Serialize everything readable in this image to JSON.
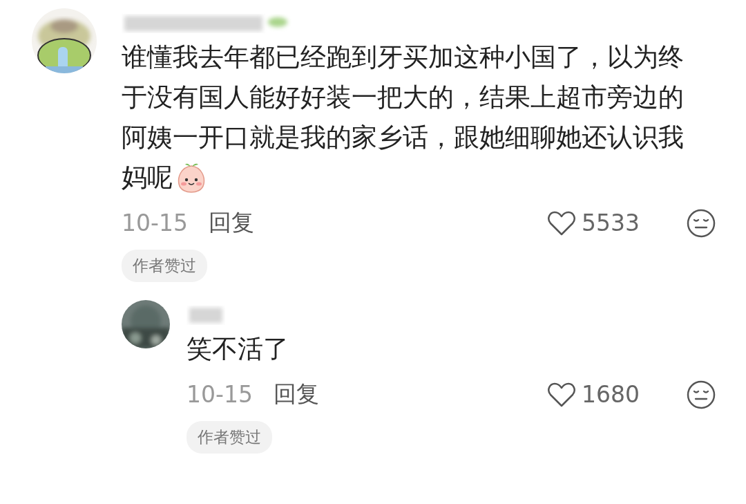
{
  "comments": [
    {
      "text": "谁懂我去年都已经跑到牙买加这种小国了，以为终于没有国人能好好装一把大的，结果上超市旁边的阿姨一开口就是我的家乡话，跟她细聊她还认识我",
      "text_end": "妈呢",
      "emoji": true,
      "date": "10-15",
      "reply": "回复",
      "likes": "5533",
      "liked": false,
      "tag": "作者赞过",
      "replies": [
        {
          "text": "笑不活了",
          "emoji": false,
          "date": "10-15",
          "reply": "回复",
          "likes": "1680",
          "liked": false,
          "tag": "作者赞过"
        }
      ]
    }
  ]
}
